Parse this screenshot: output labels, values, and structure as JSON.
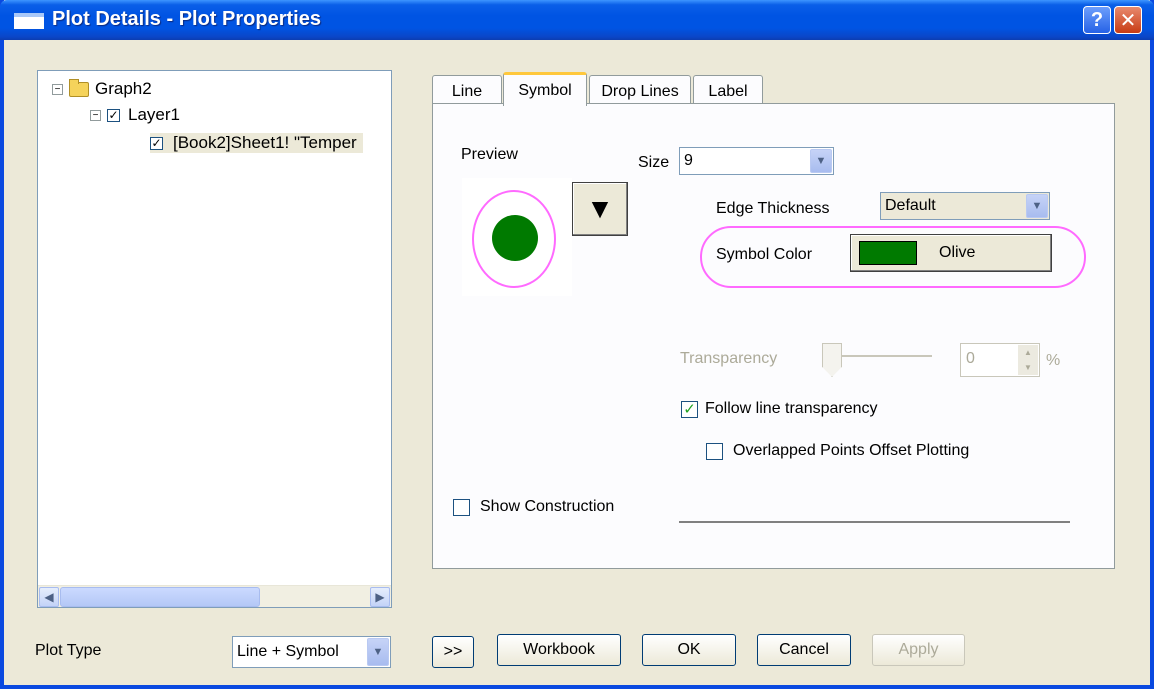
{
  "window": {
    "title": "Plot Details - Plot Properties",
    "help_label": "?",
    "close_label": "✕"
  },
  "tree": {
    "root": "Graph2",
    "layer": "Layer1",
    "plot": "[Book2]Sheet1! \"Temper",
    "expander_root": "−",
    "expander_layer": "−",
    "check": "✓"
  },
  "tabs": [
    "Line",
    "Symbol",
    "Drop Lines",
    "Label"
  ],
  "symbol": {
    "preview_label": "Preview",
    "size_label": "Size",
    "size_value": "9",
    "edge_thickness_label": "Edge Thickness",
    "edge_thickness_value": "Default",
    "symbol_color_label": "Symbol Color",
    "symbol_color_value": "Olive",
    "symbol_color_hex": "#007a00",
    "transparency_label": "Transparency",
    "transparency_value": "0",
    "transparency_unit": "%",
    "follow_line_transparency": "Follow line transparency",
    "overlapped_points": "Overlapped Points Offset Plotting",
    "show_construction": "Show Construction"
  },
  "footer": {
    "plot_type_label": "Plot Type",
    "plot_type_value": "Line + Symbol",
    "expand_label": ">>",
    "workbook_label": "Workbook",
    "ok_label": "OK",
    "cancel_label": "Cancel",
    "apply_label": "Apply"
  },
  "colors": {
    "title_bar": "#0054e3",
    "highlight_ellipse": "#ff6aff",
    "symbol": "#007a00"
  }
}
